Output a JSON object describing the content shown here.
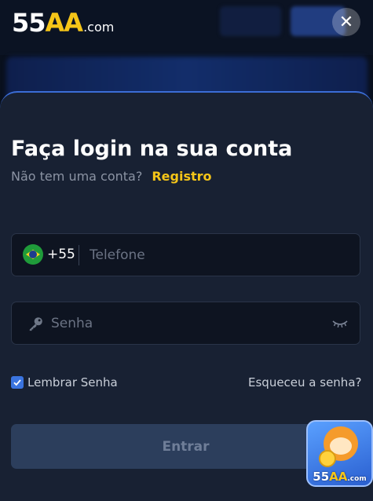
{
  "brand": {
    "main": "55",
    "accent": "AA",
    "suffix": ".com"
  },
  "close": {
    "icon": "close-icon",
    "glyph": "✕"
  },
  "login": {
    "title": "Faça login na sua conta",
    "no_account": "Não tem uma conta?",
    "register_link": "Registro",
    "phone": {
      "country_code": "+55",
      "placeholder": "Telefone",
      "flag": "brazil-flag-icon"
    },
    "password": {
      "placeholder": "Senha",
      "icon": "key-icon",
      "toggle_icon": "eye-closed-icon"
    },
    "remember_label": "Lembrar Senha",
    "remember_checked": true,
    "forgot_link": "Esqueceu a senha?",
    "submit_label": "Entrar"
  },
  "promo": {
    "main": "55",
    "accent": "AA",
    "suffix": ".com"
  },
  "colors": {
    "accent": "#f5c518",
    "primary_blue": "#3a74e0",
    "modal_bg": "#182133",
    "button_disabled": "#2c3e5c"
  }
}
